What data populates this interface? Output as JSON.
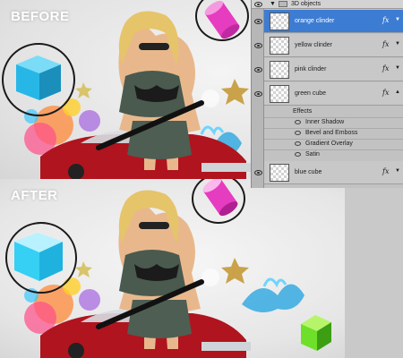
{
  "before": {
    "caption": "BEFORE"
  },
  "after": {
    "caption": "AFTER"
  },
  "layers_panel": {
    "group_name": "3D objects",
    "layers": [
      {
        "name": "orange clinder",
        "selected": true,
        "fx": "fx"
      },
      {
        "name": "yellow clinder",
        "fx": "fx"
      },
      {
        "name": "pink clinder",
        "fx": "fx"
      },
      {
        "name": "green cube",
        "fx": "fx"
      },
      {
        "name": "blue cube",
        "fx": "fx"
      }
    ],
    "effects_label": "Effects",
    "effects": [
      "Inner Shadow",
      "Bevel and Emboss",
      "Gradient Overlay",
      "Satin"
    ]
  },
  "colors": {
    "selected_row": "#3d7cd3",
    "cube_before": "#27b7e6",
    "cube_after": "#35d0f3",
    "cylinder": "#e63cc0",
    "green_cube": "#6ee02a",
    "car": "#b0141e"
  }
}
